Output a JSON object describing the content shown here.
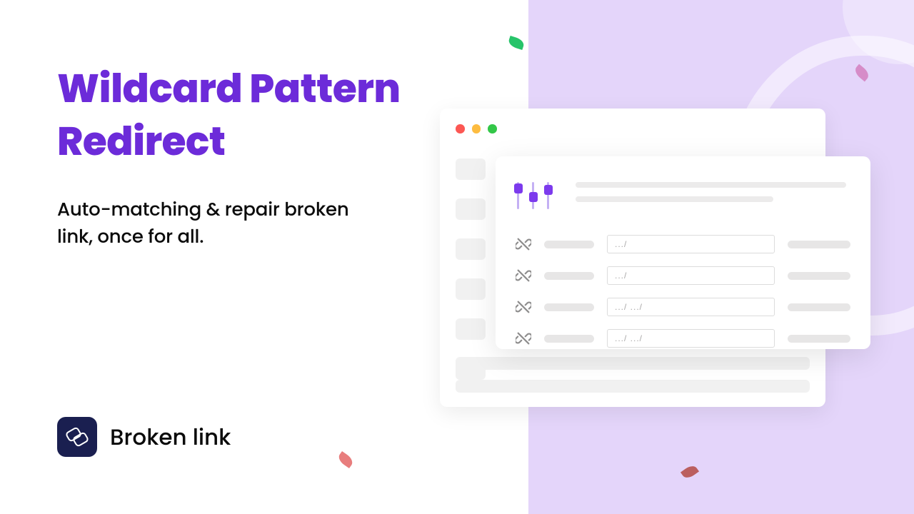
{
  "heading_line1": "Wildcard Pattern",
  "heading_line2": "Redirect",
  "subheading_line1": "Auto-matching & repair broken",
  "subheading_line2": "link, once for all.",
  "logo_text": "Broken link",
  "rows": [
    {
      "pattern": ".../"
    },
    {
      "pattern": ".../"
    },
    {
      "pattern": ".../ .../"
    },
    {
      "pattern": ".../ .../"
    }
  ]
}
